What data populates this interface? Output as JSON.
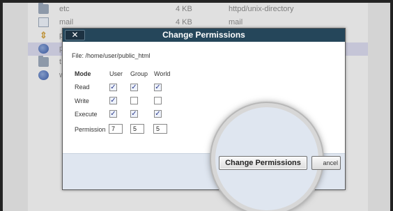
{
  "files": [
    {
      "name": "etc",
      "size": "4 KB",
      "type": "httpd/unix-directory",
      "icon": "folder-icon"
    },
    {
      "name": "mail",
      "size": "4 KB",
      "type": "mail",
      "icon": "file-icon"
    },
    {
      "name": "p",
      "size": "",
      "type": "",
      "icon": "arrows-icon"
    },
    {
      "name": "p",
      "size": "",
      "type": "",
      "icon": "globe-icon"
    },
    {
      "name": "t",
      "size": "",
      "type": "",
      "icon": "folder-icon"
    },
    {
      "name": "w",
      "size": "",
      "type": "",
      "icon": "globe-icon"
    }
  ],
  "dialog": {
    "title": "Change Permissions",
    "close_label": "✕",
    "file_label": "File: /home/user/public_html",
    "headers": {
      "mode": "Mode",
      "user": "User",
      "group": "Group",
      "world": "World"
    },
    "rows": {
      "read": {
        "label": "Read",
        "user": true,
        "group": true,
        "world": true
      },
      "write": {
        "label": "Write",
        "user": true,
        "group": false,
        "world": false
      },
      "execute": {
        "label": "Execute",
        "user": true,
        "group": true,
        "world": true
      }
    },
    "permission": {
      "label": "Permission",
      "user": "7",
      "group": "5",
      "world": "5"
    },
    "change_button": "Change Permissions",
    "cancel_button": "ancel"
  },
  "colors": {
    "title_bar": "#25465a",
    "footer": "#dfe6f0",
    "selected_row": "#d6d6ea"
  }
}
